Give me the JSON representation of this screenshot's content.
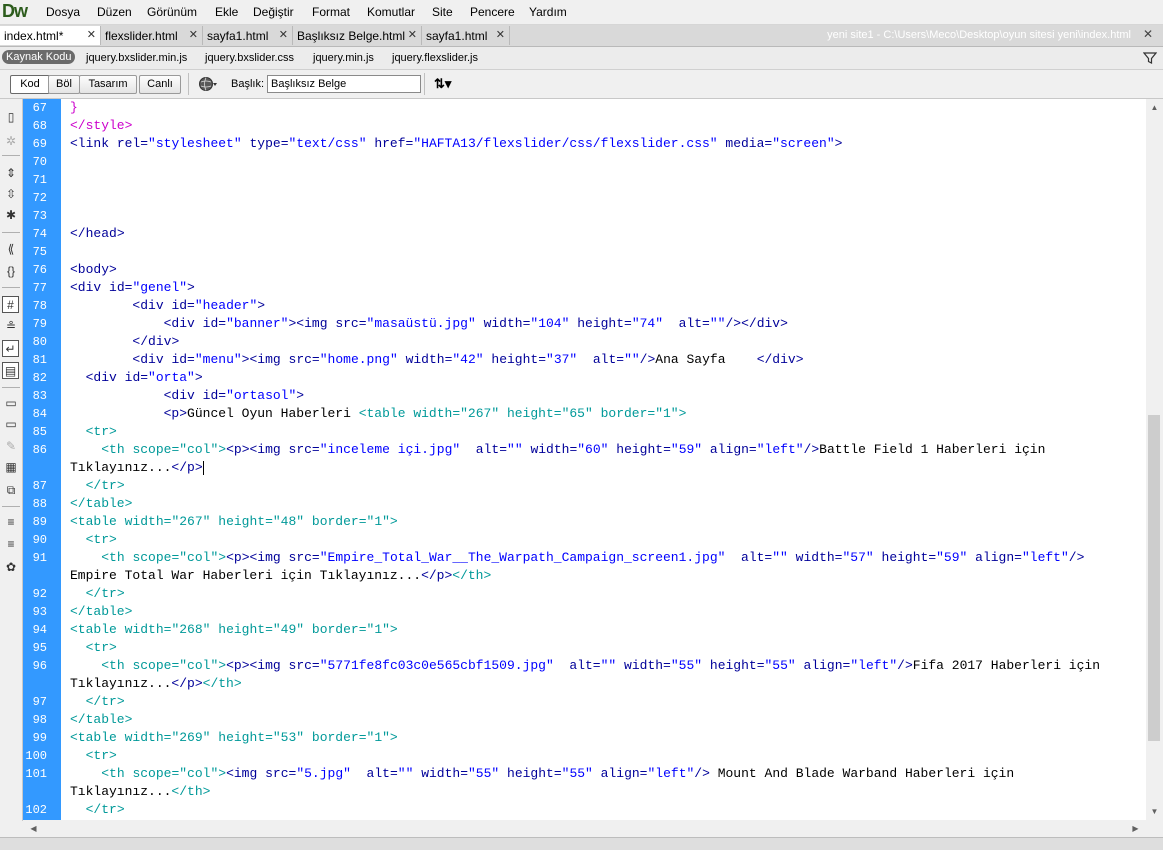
{
  "app": {
    "logo": "Dw"
  },
  "menu": {
    "items": [
      "Dosya",
      "Düzen",
      "Görünüm",
      "Ekle",
      "Değiştir",
      "Format",
      "Komutlar",
      "Site",
      "Pencere",
      "Yardım"
    ]
  },
  "tabs": [
    {
      "label": "index.html*",
      "active": true
    },
    {
      "label": "flexslider.html",
      "active": false
    },
    {
      "label": "sayfa1.html",
      "active": false
    },
    {
      "label": "Başlıksız Belge.html",
      "active": false
    },
    {
      "label": "sayfa1.html",
      "active": false
    }
  ],
  "window": {
    "path": "yeni site1 - C:\\Users\\Meco\\Desktop\\oyun sitesi yeni\\index.html"
  },
  "related": {
    "source": "Kaynak Kodu",
    "files": [
      "jquery.bxslider.min.js",
      "jquery.bxslider.css",
      "jquery.min.js",
      "jquery.flexslider.js"
    ]
  },
  "docbar": {
    "views": [
      "Kod",
      "Böl",
      "Tasarım",
      "Canlı"
    ],
    "active_view": "Kod",
    "title_label": "Başlık:",
    "title_value": "Başlıksız Belge"
  },
  "editor": {
    "line_numbers": [
      "67",
      "68",
      "69",
      "70",
      "71",
      "72",
      "73",
      "74",
      "75",
      "76",
      "77",
      "78",
      "79",
      "80",
      "81",
      "82",
      "83",
      "84",
      "85",
      "86",
      "",
      "87",
      "88",
      "89",
      "90",
      "91",
      "",
      "92",
      "93",
      "94",
      "95",
      "96",
      "",
      "97",
      "98",
      "99",
      "100",
      "101",
      "",
      "102"
    ],
    "lines": [
      "}",
      "</style>",
      "<link rel=\"stylesheet\" type=\"text/css\" href=\"HAFTA13/flexslider/css/flexslider.css\" media=\"screen\">",
      "",
      "",
      "",
      "",
      "</head>",
      "",
      "<body>",
      "<div id=\"genel\">",
      "        <div id=\"header\">",
      "            <div id=\"banner\"><img src=\"masaüstü.jpg\" width=\"104\" height=\"74\"  alt=\"\"/></div>",
      "        </div>",
      "        <div id=\"menu\"><img src=\"home.png\" width=\"42\" height=\"37\"  alt=\"\"/>Ana Sayfa    </div>",
      "  <div id=\"orta\">",
      "            <div id=\"ortasol\">",
      "            <p>Güncel Oyun Haberleri <table width=\"267\" height=\"65\" border=\"1\">",
      "  <tr>",
      "    <th scope=\"col\"><p><img src=\"inceleme içi.jpg\"  alt=\"\" width=\"60\" height=\"59\" align=\"left\"/>Battle Field 1 Haberleri için",
      "Tıklayınız...</p>",
      "  </tr>",
      "</table>",
      "<table width=\"267\" height=\"48\" border=\"1\">",
      "  <tr>",
      "    <th scope=\"col\"><p><img src=\"Empire_Total_War__The_Warpath_Campaign_screen1.jpg\"  alt=\"\" width=\"57\" height=\"59\" align=\"left\"/>",
      "Empire Total War Haberleri için Tıklayınız...</p></th>",
      "  </tr>",
      "</table>",
      "<table width=\"268\" height=\"49\" border=\"1\">",
      "  <tr>",
      "    <th scope=\"col\"><p><img src=\"5771fe8fc03c0e565cbf1509.jpg\"  alt=\"\" width=\"55\" height=\"55\" align=\"left\"/>Fifa 2017 Haberleri için",
      "Tıklayınız...</p></th>",
      "  </tr>",
      "</table>",
      "<table width=\"269\" height=\"53\" border=\"1\">",
      "  <tr>",
      "    <th scope=\"col\"><img src=\"5.jpg\"  alt=\"\" width=\"55\" height=\"55\" align=\"left\"/> Mount And Blade Warband Haberleri için",
      "Tıklayınız...</th>",
      "  </tr>"
    ]
  }
}
